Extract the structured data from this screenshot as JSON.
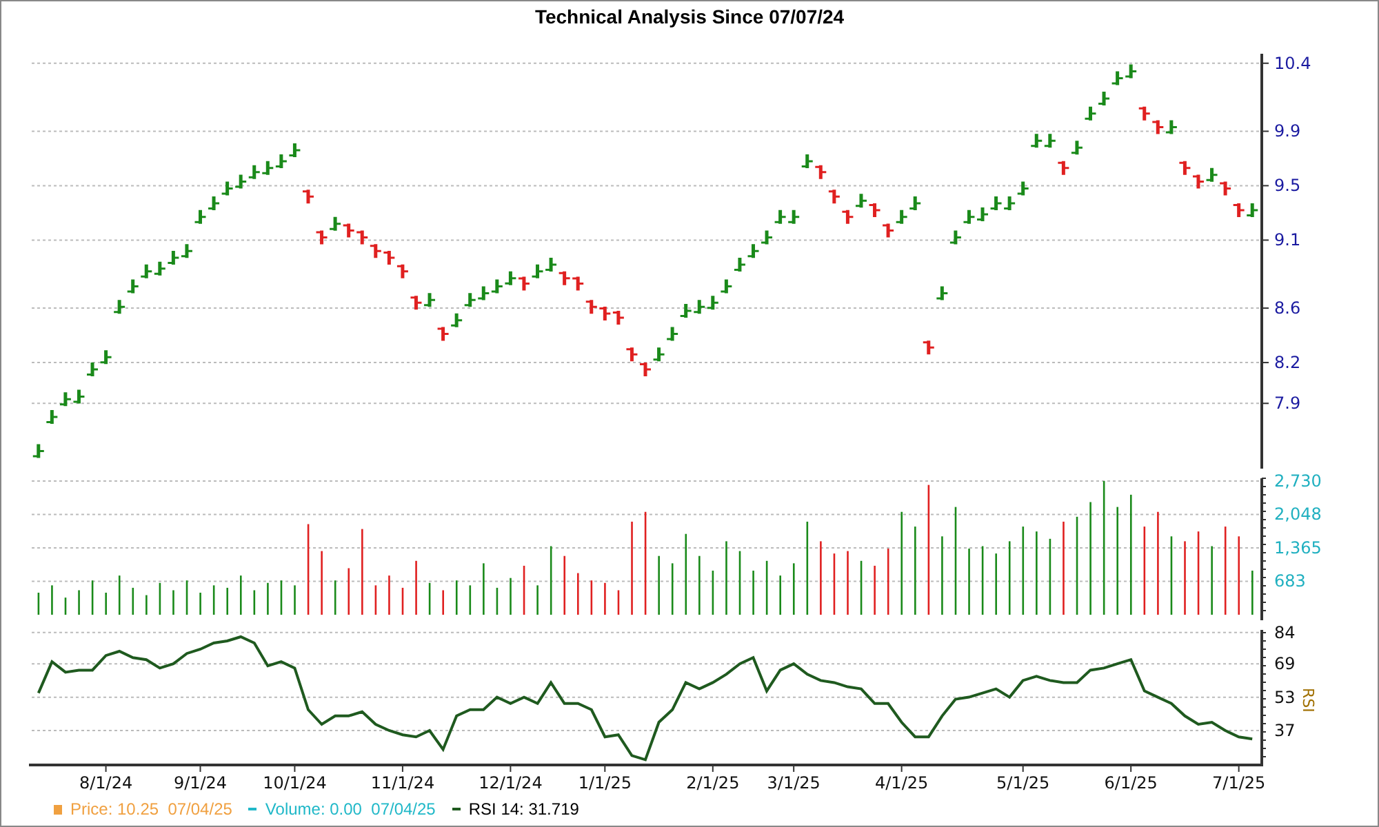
{
  "title": "Technical Analysis Since 07/07/24",
  "price_panel": {
    "chart_data": {
      "type": "scatter",
      "grid": true,
      "ylim": [
        7.4,
        10.49
      ],
      "categories": [
        null,
        null,
        null,
        null,
        null,
        null,
        null,
        null,
        null,
        null,
        null,
        null,
        null,
        null,
        null,
        null,
        null,
        null,
        null,
        null,
        null,
        null,
        null,
        null,
        null,
        null,
        null,
        null,
        null,
        null,
        null,
        null,
        null,
        null,
        null,
        null,
        null,
        null,
        null,
        null,
        null,
        null,
        null,
        null,
        null,
        null,
        null,
        null,
        null,
        null,
        null,
        null,
        null,
        null,
        null,
        null,
        null,
        null,
        null,
        null,
        null,
        null,
        null,
        null,
        null,
        null,
        null,
        null,
        null,
        null,
        null,
        null,
        null,
        null,
        null,
        null,
        null,
        null,
        null,
        null,
        null,
        null,
        null,
        null,
        null,
        null,
        null,
        null,
        null,
        null,
        null
      ],
      "series": [
        {
          "color": "#1a8a1a",
          "values": [
            7.55,
            7.8,
            7.93,
            7.95,
            8.15,
            8.24,
            8.61,
            8.76,
            8.87,
            8.89,
            8.97,
            9.02,
            9.27,
            9.37,
            9.48,
            9.53,
            9.6,
            9.63,
            9.68,
            9.76,
            null,
            null,
            9.22,
            null,
            null,
            null,
            null,
            null,
            null,
            8.66,
            null,
            8.51,
            8.66,
            8.71,
            8.76,
            8.82,
            null,
            8.87,
            8.92,
            null,
            null,
            null,
            null,
            null,
            null,
            null,
            8.26,
            8.41,
            8.58,
            8.61,
            8.64,
            8.76,
            8.92,
            9.02,
            9.12,
            9.27,
            9.27,
            9.68,
            null,
            null,
            null,
            9.39,
            null,
            null,
            9.27,
            9.37,
            null,
            8.71,
            9.12,
            9.27,
            9.29,
            9.37,
            9.37,
            9.48,
            9.83,
            9.83,
            null,
            9.78,
            10.03,
            10.14,
            10.29,
            10.34,
            null,
            null,
            9.93,
            null,
            null,
            9.58,
            null,
            null,
            9.32
          ]
        },
        {
          "color": "#e02020",
          "values": [
            null,
            null,
            null,
            null,
            null,
            null,
            null,
            null,
            null,
            null,
            null,
            null,
            null,
            null,
            null,
            null,
            null,
            null,
            null,
            null,
            9.42,
            9.12,
            null,
            9.17,
            9.12,
            9.02,
            8.97,
            8.87,
            8.64,
            null,
            8.41,
            null,
            null,
            null,
            null,
            null,
            8.78,
            null,
            null,
            8.82,
            8.78,
            8.61,
            8.56,
            8.53,
            8.26,
            8.15,
            null,
            null,
            null,
            null,
            null,
            null,
            null,
            null,
            null,
            null,
            null,
            null,
            9.6,
            9.42,
            9.27,
            null,
            9.32,
            9.17,
            null,
            null,
            8.31,
            null,
            null,
            null,
            null,
            null,
            null,
            null,
            null,
            null,
            9.63,
            null,
            null,
            null,
            null,
            null,
            10.03,
            9.93,
            null,
            9.63,
            9.53,
            null,
            9.48,
            9.32,
            null
          ]
        }
      ],
      "yticks": [
        7.9,
        8.2,
        8.6,
        9.1,
        9.5,
        9.9,
        10.4
      ]
    }
  },
  "volume_panel": {
    "chart_data": {
      "type": "bar",
      "grid": true,
      "ylim": [
        0,
        2842
      ],
      "categories": [
        null,
        null,
        null,
        null,
        null,
        null,
        null,
        null,
        null,
        null,
        null,
        null,
        null,
        null,
        null,
        null,
        null,
        null,
        null,
        null,
        null,
        null,
        null,
        null,
        null,
        null,
        null,
        null,
        null,
        null,
        null,
        null,
        null,
        null,
        null,
        null,
        null,
        null,
        null,
        null,
        null,
        null,
        null,
        null,
        null,
        null,
        null,
        null,
        null,
        null,
        null,
        null,
        null,
        null,
        null,
        null,
        null,
        null,
        null,
        null,
        null,
        null,
        null,
        null,
        null,
        null,
        null,
        null,
        null,
        null,
        null,
        null,
        null,
        null,
        null,
        null,
        null,
        null,
        null,
        null,
        null,
        null,
        null,
        null,
        null,
        null,
        null,
        null,
        null,
        null,
        null
      ],
      "series": [
        {
          "values": [
            450,
            600,
            350,
            500,
            700,
            450,
            800,
            550,
            400,
            650,
            500,
            700,
            450,
            600,
            550,
            800,
            500,
            650,
            700,
            600,
            1850,
            1300,
            700,
            950,
            1750,
            600,
            800,
            550,
            1100,
            650,
            500,
            700,
            600,
            1050,
            550,
            750,
            1000,
            600,
            1400,
            1200,
            850,
            700,
            650,
            500,
            1900,
            2100,
            1200,
            1050,
            1650,
            1200,
            900,
            1500,
            1300,
            900,
            1100,
            800,
            1050,
            1900,
            1500,
            1250,
            1300,
            1100,
            1000,
            1350,
            2100,
            1800,
            2650,
            1600,
            2200,
            1350,
            1400,
            1250,
            1500,
            1800,
            1700,
            1550,
            1900,
            2000,
            2300,
            2730,
            2200,
            2450,
            1800,
            2100,
            1600,
            1500,
            1700,
            1400,
            1800,
            1600,
            900
          ]
        }
      ],
      "yticks": [
        {
          "value": 683,
          "label": "683"
        },
        {
          "value": 1365,
          "label": "1,365"
        },
        {
          "value": 2048,
          "label": "2,048"
        },
        {
          "value": 2730,
          "label": "2,730"
        }
      ]
    }
  },
  "rsi_panel": {
    "chart_data": {
      "type": "line",
      "grid": true,
      "ylabel": "RSI",
      "ylim": [
        20.5,
        86.6
      ],
      "categories": [
        null,
        null,
        null,
        null,
        null,
        "8/1/24",
        null,
        null,
        null,
        null,
        null,
        null,
        "9/1/24",
        null,
        null,
        null,
        null,
        null,
        null,
        "10/1/24",
        null,
        null,
        null,
        null,
        null,
        null,
        null,
        "11/1/24",
        null,
        null,
        null,
        null,
        null,
        null,
        null,
        "12/1/24",
        null,
        null,
        null,
        null,
        null,
        null,
        "1/1/25",
        null,
        null,
        null,
        null,
        null,
        null,
        null,
        "2/1/25",
        null,
        null,
        null,
        null,
        null,
        "3/1/25",
        null,
        null,
        null,
        null,
        null,
        null,
        null,
        "4/1/25",
        null,
        null,
        null,
        null,
        null,
        null,
        null,
        null,
        "5/1/25",
        null,
        null,
        null,
        null,
        null,
        null,
        null,
        "6/1/25",
        null,
        null,
        null,
        null,
        null,
        null,
        null,
        "7/1/25",
        null
      ],
      "series": [
        {
          "color": "#1f5a1f",
          "values": [
            55,
            70,
            65,
            66,
            66,
            73,
            75,
            72,
            71,
            67,
            69,
            74,
            76,
            79,
            80,
            82,
            79,
            68,
            70,
            67,
            47,
            40,
            44,
            44,
            46,
            40,
            37,
            35,
            34,
            37,
            28,
            44,
            47,
            47,
            53,
            50,
            53,
            50,
            60,
            50,
            50,
            47,
            34,
            35,
            25,
            23,
            41,
            47,
            60,
            57,
            60,
            64,
            69,
            72,
            56,
            66,
            69,
            64,
            61,
            60,
            58,
            57,
            50,
            50,
            41,
            34,
            34,
            44,
            52,
            53,
            55,
            57,
            53,
            61,
            63,
            61,
            60,
            60,
            66,
            67,
            69,
            71,
            56,
            53,
            50,
            44,
            40,
            41,
            37,
            34,
            33
          ]
        }
      ],
      "yticks": [
        37,
        53,
        69,
        84
      ]
    }
  },
  "legend": [
    {
      "text": "Price: 10.25  07/04/25",
      "color": "#f0a040"
    },
    {
      "text": "Volume: 0.00  07/04/25",
      "color": "#20b8c8"
    },
    {
      "text": "RSI 14: 31.719",
      "color": "#1f5a1f"
    }
  ]
}
